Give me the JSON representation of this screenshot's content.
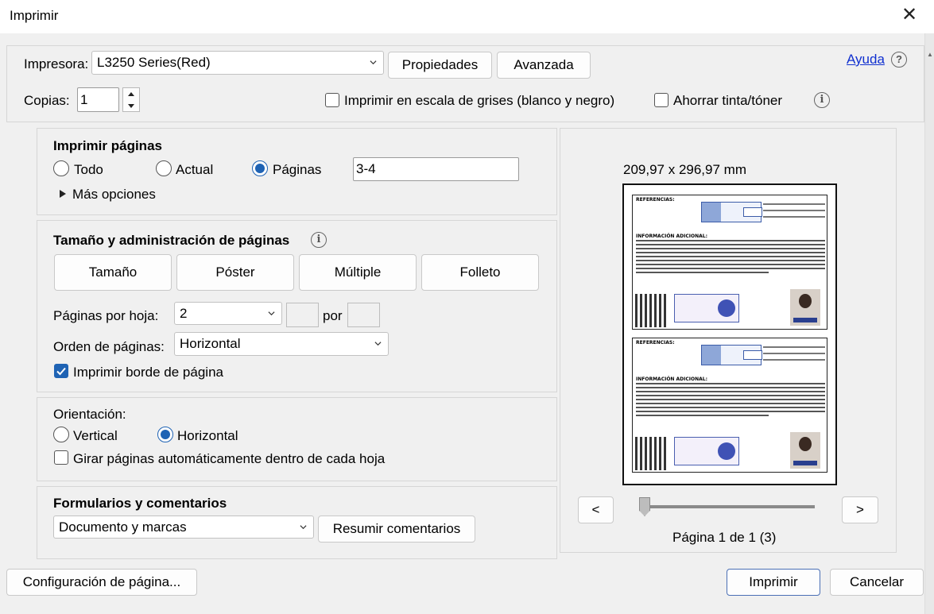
{
  "window": {
    "title": "Imprimir",
    "close_glyph": "✕"
  },
  "printer": {
    "label": "Impresora:",
    "value": "L3250 Series(Red)",
    "properties_button": "Propiedades",
    "advanced_button": "Avanzada",
    "help_link": "Ayuda",
    "help_icon": "?"
  },
  "copies": {
    "label": "Copias:",
    "value": "1"
  },
  "options": {
    "grayscale_label": "Imprimir en escala de grises (blanco y negro)",
    "grayscale_checked": false,
    "save_ink_label": "Ahorrar tinta/tóner",
    "save_ink_checked": false
  },
  "pages": {
    "heading": "Imprimir páginas",
    "radio_all": "Todo",
    "radio_current": "Actual",
    "radio_pages": "Páginas",
    "selected": "Páginas",
    "range_value": "3-4",
    "more_options": "Más opciones"
  },
  "sizing": {
    "heading": "Tamaño y administración de páginas",
    "btn_size": "Tamaño",
    "btn_poster": "Póster",
    "btn_multiple": "Múltiple",
    "btn_booklet": "Folleto",
    "pages_per_sheet_label": "Páginas por hoja:",
    "pages_per_sheet_value": "2",
    "by_label": "por",
    "page_order_label": "Orden de páginas:",
    "page_order_value": "Horizontal",
    "print_border_label": "Imprimir borde de página",
    "print_border_checked": true
  },
  "orientation": {
    "heading": "Orientación:",
    "vertical": "Vertical",
    "horizontal": "Horizontal",
    "selected": "Horizontal",
    "auto_rotate_label": "Girar páginas automáticamente dentro de cada hoja",
    "auto_rotate_checked": false
  },
  "forms": {
    "heading": "Formularios y comentarios",
    "value": "Documento y marcas",
    "summarize_button": "Resumir comentarios"
  },
  "preview": {
    "dimensions": "209,97 x 296,97 mm",
    "prev": "<",
    "next": ">",
    "page_status": "Página 1 de 1 (3)",
    "slider_position": 0,
    "mini_heading_1": "REFERENCIAS:",
    "mini_heading_2": "INFORMACIÓN ADICIONAL:"
  },
  "footer": {
    "page_setup": "Configuración de página...",
    "print": "Imprimir",
    "cancel": "Cancelar"
  }
}
